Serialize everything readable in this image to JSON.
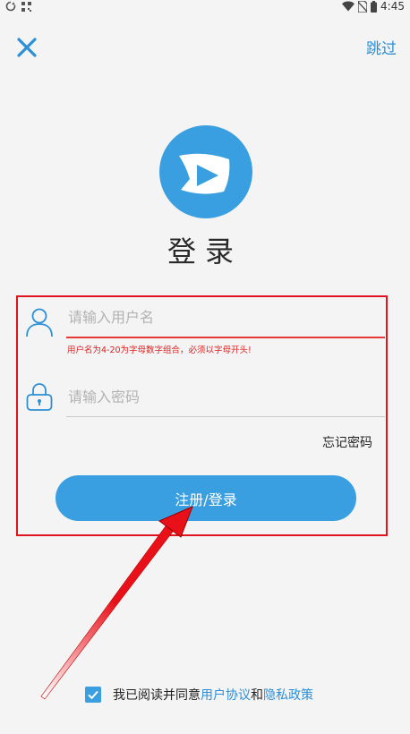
{
  "status_bar": {
    "time": "4:45"
  },
  "header": {
    "skip_label": "跳过"
  },
  "title": "登录",
  "form": {
    "username_placeholder": "请输入用户名",
    "username_error": "用户名为4-20为字母数字组合，必须以字母开头!",
    "password_placeholder": "请输入密码",
    "forgot_label": "忘记密码",
    "submit_label": "注册/登录"
  },
  "agreement": {
    "prefix": "我已阅读并同意",
    "user_agreement": "用户协议",
    "and": "和",
    "privacy_policy": "隐私政策",
    "checked": true
  },
  "colors": {
    "accent": "#3a9fe0",
    "link": "#2d8fd5",
    "error": "#e02020",
    "annotation": "#e0141e"
  }
}
